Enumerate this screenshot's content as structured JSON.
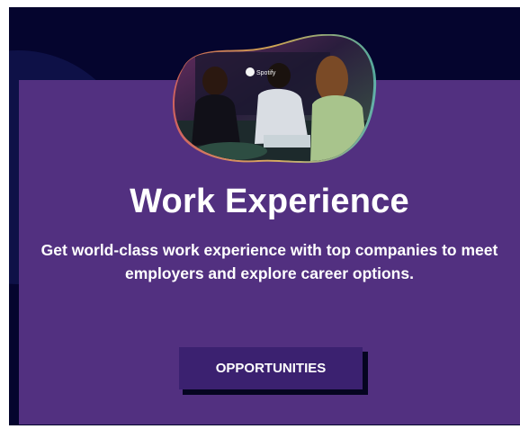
{
  "section": {
    "title": "Work Experience",
    "description": "Get world-class work experience with top companies to meet employers and explore career options.",
    "cta_label": "OPPORTUNITIES",
    "photo_text": "Spotify"
  },
  "colors": {
    "background": "#05052e",
    "card": "#523080",
    "button": "#3b2170",
    "text": "#ffffff"
  }
}
